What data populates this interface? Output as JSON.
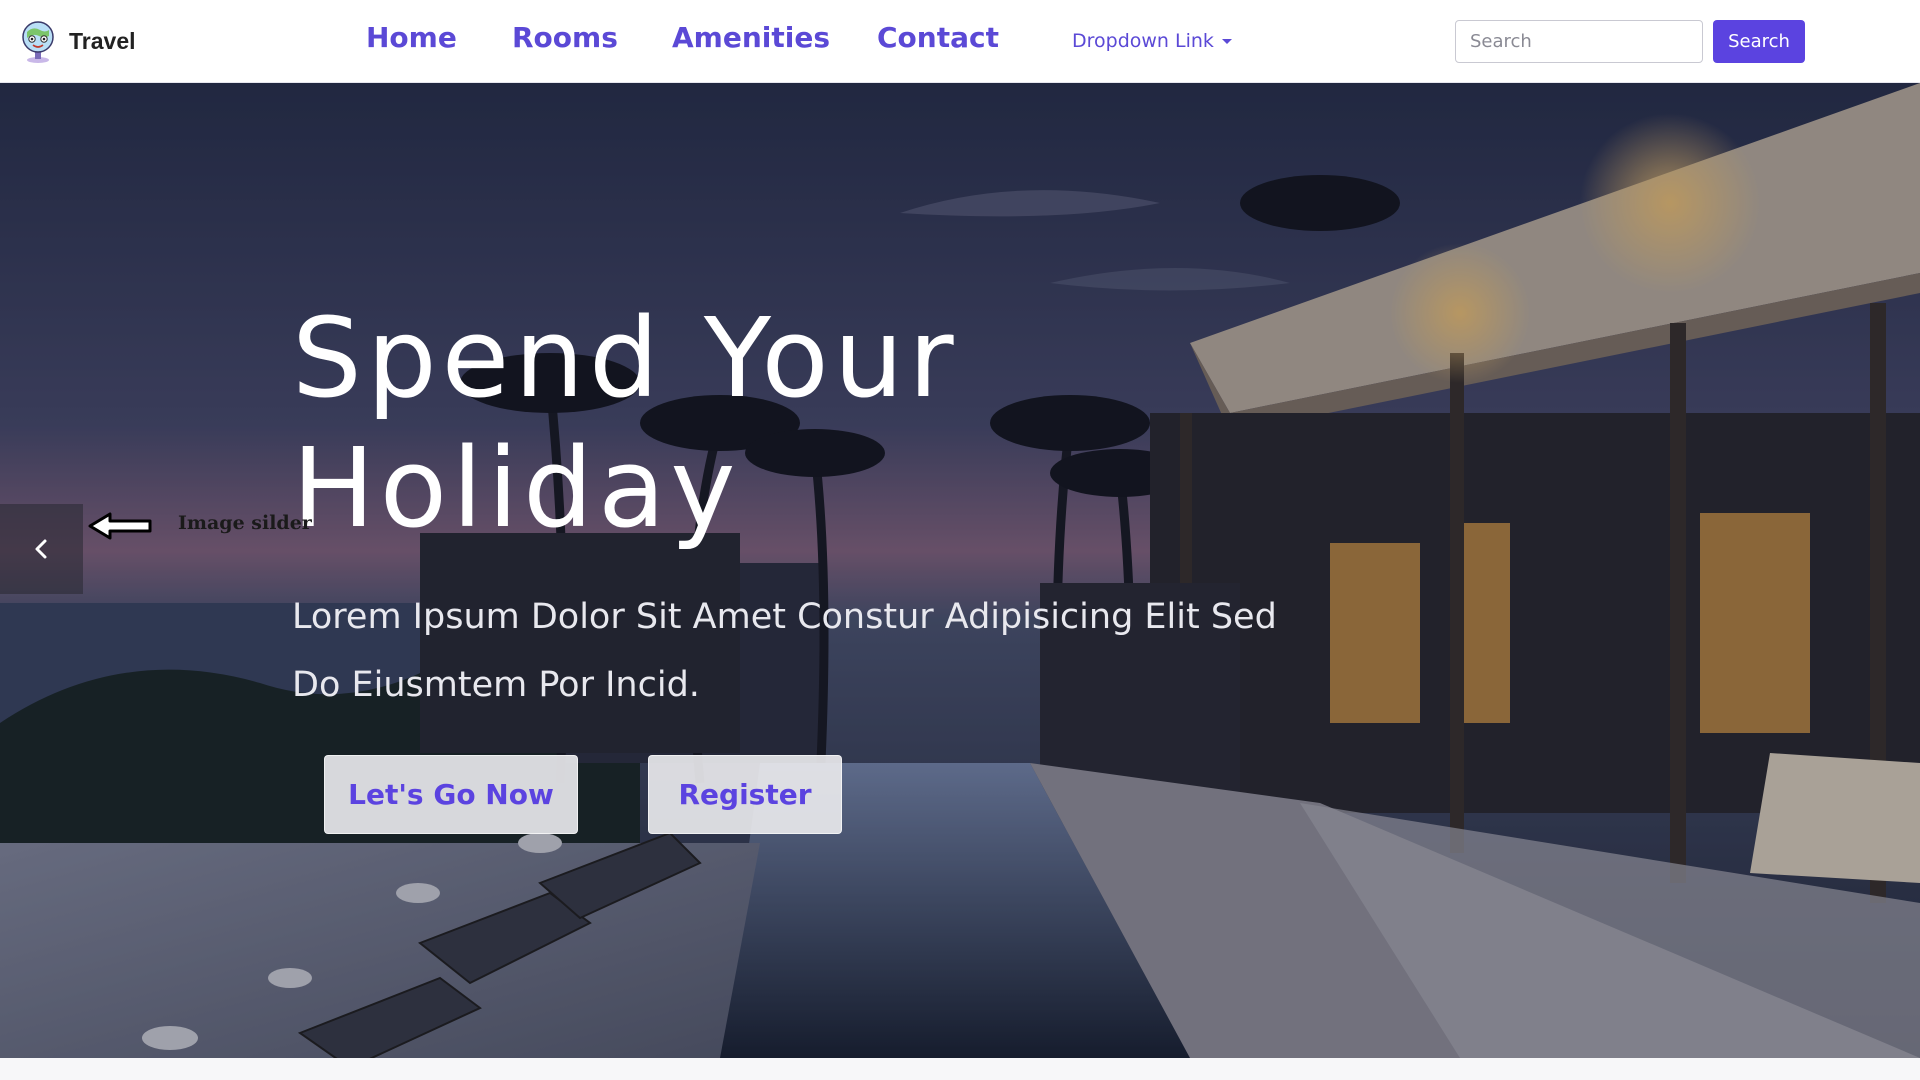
{
  "brand": {
    "name": "Travel",
    "logo_icon": "globe-mascot-icon"
  },
  "nav": {
    "links": [
      {
        "label": "Home"
      },
      {
        "label": "Rooms"
      },
      {
        "label": "Amenities"
      },
      {
        "label": "Contact"
      }
    ],
    "dropdown_label": "Dropdown Link",
    "dropdown_icon": "caret-down-icon"
  },
  "search": {
    "placeholder": "Search",
    "button_label": "Search"
  },
  "hero": {
    "title_line1": "Spend Your",
    "title_line2": "Holiday",
    "subtitle": "Lorem Ipsum Dolor Sit Amet Constur Adipisicing Elit Sed Do Eiusmtem Por Incid.",
    "primary_button": "Let's Go Now",
    "secondary_button": "Register",
    "prev_icon": "chevron-left-icon"
  },
  "annotation": {
    "label": "Image silder",
    "icon": "arrow-left-icon"
  },
  "colors": {
    "accent": "#5b43e0",
    "nav_link": "#5b49d6",
    "navbar_bg": "#ffffff",
    "hero_text": "#ffffff"
  }
}
